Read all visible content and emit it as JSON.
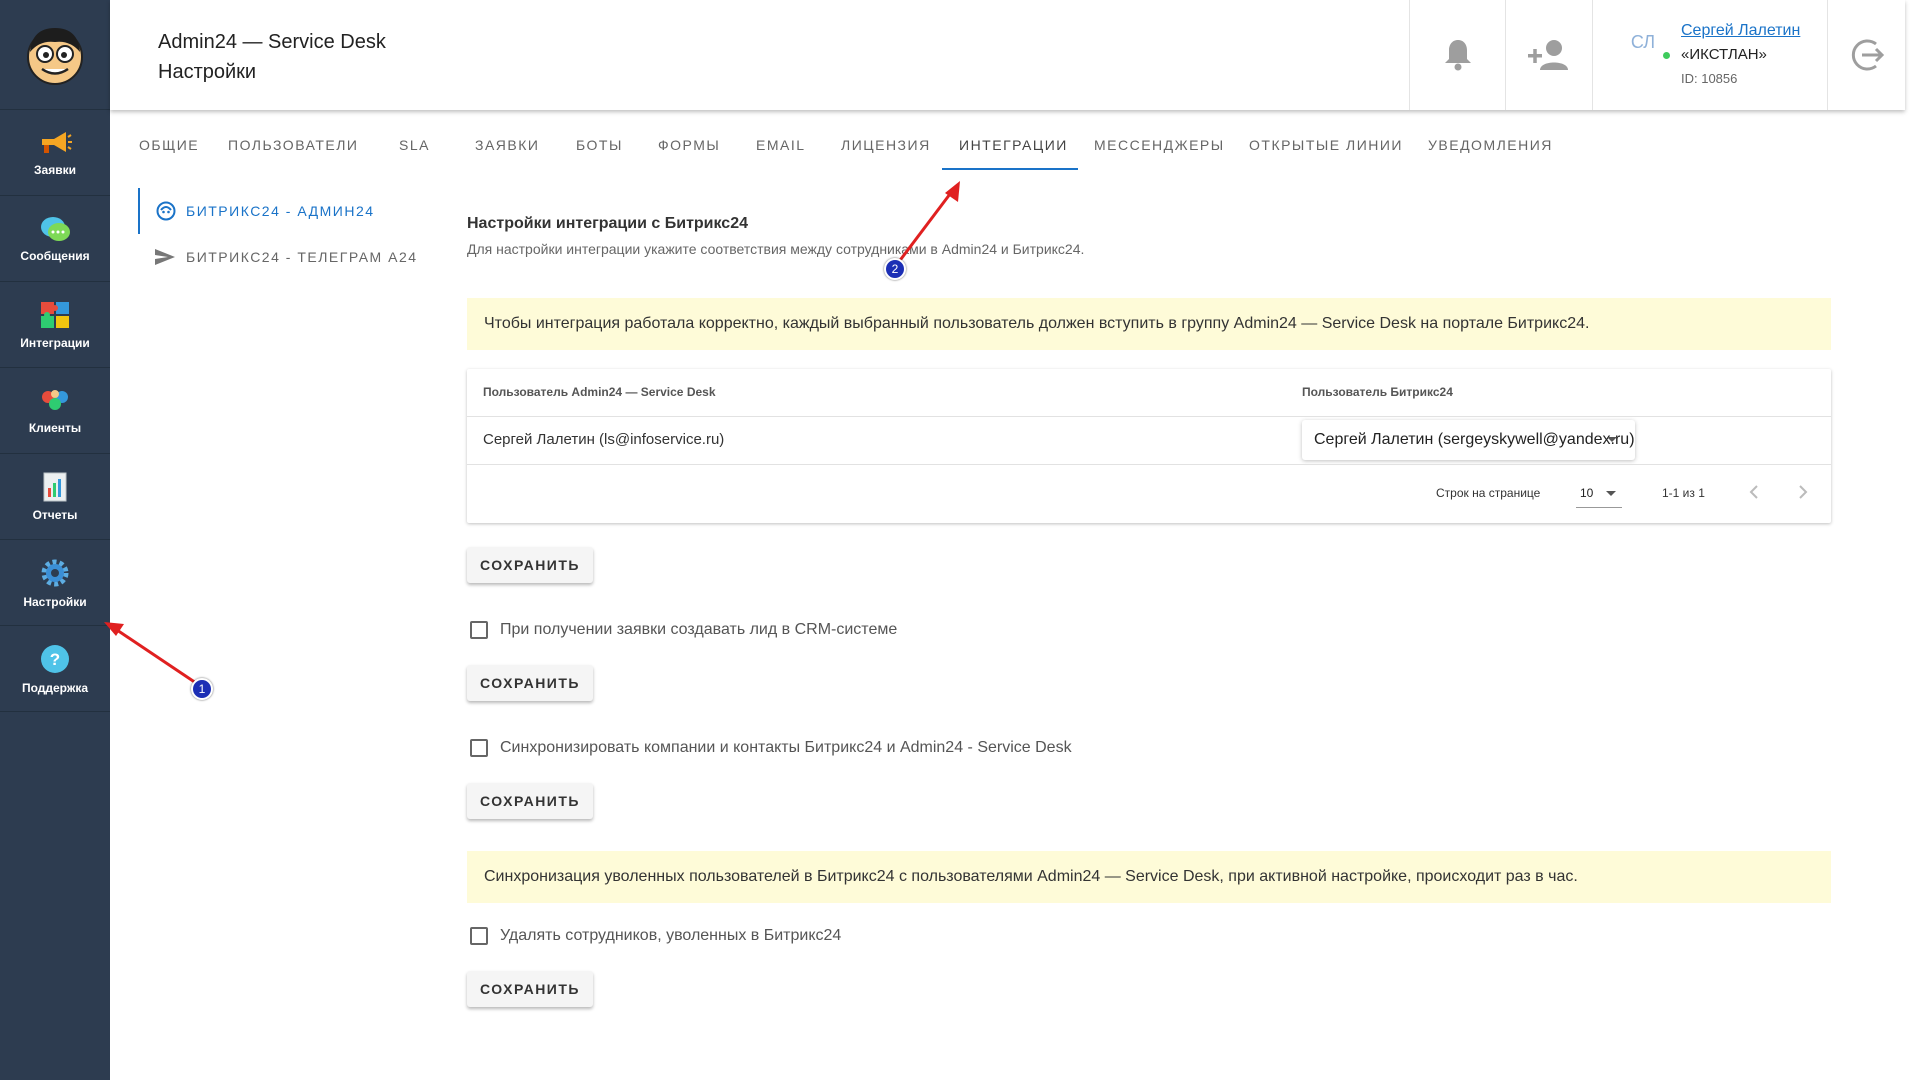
{
  "app": {
    "title_line1": "Admin24 — Service Desk",
    "title_line2": "Настройки"
  },
  "sidebar": {
    "items": [
      {
        "label": "Заявки",
        "icon": "megaphone-icon"
      },
      {
        "label": "Сообщения",
        "icon": "chat-bubbles-icon"
      },
      {
        "label": "Интеграции",
        "icon": "puzzle-icon"
      },
      {
        "label": "Клиенты",
        "icon": "clients-icon"
      },
      {
        "label": "Отчеты",
        "icon": "report-icon"
      },
      {
        "label": "Настройки",
        "icon": "gear-icon"
      },
      {
        "label": "Поддержка",
        "icon": "help-icon"
      }
    ]
  },
  "header": {
    "user": {
      "initials": "СЛ",
      "name": "Сергей Лалетин",
      "org": "«ИКСТЛАН»",
      "id": "ID: 10856"
    }
  },
  "tabs": [
    {
      "label": "ОБЩИЕ"
    },
    {
      "label": "ПОЛЬЗОВАТЕЛИ"
    },
    {
      "label": "SLA"
    },
    {
      "label": "ЗАЯВКИ"
    },
    {
      "label": "БОТЫ"
    },
    {
      "label": "ФОРМЫ"
    },
    {
      "label": "EMAIL"
    },
    {
      "label": "ЛИЦЕНЗИЯ"
    },
    {
      "label": "ИНТЕГРАЦИИ"
    },
    {
      "label": "МЕССЕНДЖЕРЫ"
    },
    {
      "label": "ОТКРЫТЫЕ ЛИНИИ"
    },
    {
      "label": "УВЕДОМЛЕНИЯ"
    }
  ],
  "active_tab": "ИНТЕГРАЦИИ",
  "submenu": {
    "items": [
      {
        "label": "БИТРИКС24 - АДМИН24",
        "icon": "bitrix-icon"
      },
      {
        "label": "БИТРИКС24 - ТЕЛЕГРАМ А24",
        "icon": "send-icon"
      }
    ]
  },
  "main": {
    "title": "Настройки интеграции с Битрикс24",
    "description": "Для настройки интеграции укажите соответствия между сотрудниками в Admin24 и Битрикс24.",
    "notice1": "Чтобы интеграция работала корректно, каждый выбранный пользователь должен вступить в группу Admin24 — Service Desk на портале Битрикс24.",
    "table": {
      "col1": "Пользователь Admin24 — Service Desk",
      "col2": "Пользователь Битрикс24",
      "rows": [
        {
          "admin_user": "Сергей Лалетин (ls@infoservice.ru)",
          "bitrix_user": "Сергей Лалетин (sergeyskywell@yandex.ru)"
        }
      ],
      "rows_per_page_label": "Строк на странице",
      "rows_per_page": "10",
      "range": "1-1 из 1"
    },
    "save_label": "СОХРАНИТЬ",
    "check_lead": "При получении заявки создавать лид в CRM-системе",
    "check_sync": "Синхронизировать компании и контакты Битрикс24 и Admin24 - Service Desk",
    "notice2": "Синхронизация уволенных пользователей в Битрикс24 с пользователями Admin24 — Service Desk, при активной настройке, происходит раз в час.",
    "check_delete": "Удалять сотрудников, уволенных в Битрикс24"
  },
  "annotations": {
    "badge1": "1",
    "badge2": "2"
  }
}
